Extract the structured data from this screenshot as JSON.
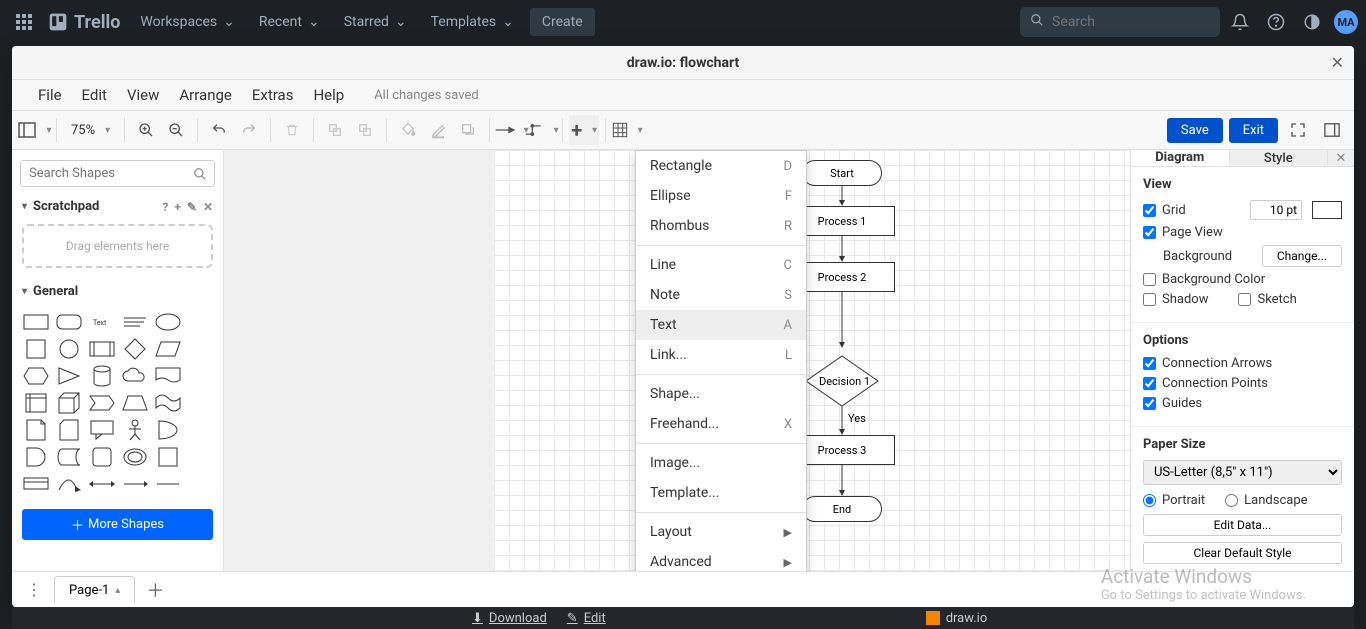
{
  "trello_nav": {
    "logo": "Trello",
    "items": [
      "Workspaces",
      "Recent",
      "Starred",
      "Templates"
    ],
    "create": "Create",
    "search_placeholder": "Search",
    "avatar": "MA"
  },
  "modal": {
    "title": "draw.io: flowchart"
  },
  "menubar": {
    "items": [
      "File",
      "Edit",
      "View",
      "Arrange",
      "Extras",
      "Help"
    ],
    "status": "All changes saved"
  },
  "toolbar": {
    "zoom": "75%",
    "save": "Save",
    "exit": "Exit"
  },
  "left_panel": {
    "search_placeholder": "Search Shapes",
    "scratchpad_title": "Scratchpad",
    "scratchpad_body": "Drag elements here",
    "general_title": "General",
    "more_shapes": "More Shapes"
  },
  "ctx_menu": {
    "items": [
      {
        "label": "Rectangle",
        "shortcut": "D"
      },
      {
        "label": "Ellipse",
        "shortcut": "F"
      },
      {
        "label": "Rhombus",
        "shortcut": "R"
      },
      {
        "divider": true
      },
      {
        "label": "Line",
        "shortcut": "C"
      },
      {
        "label": "Note",
        "shortcut": "S"
      },
      {
        "label": "Text",
        "shortcut": "A",
        "hover": true
      },
      {
        "label": "Link...",
        "shortcut": "L"
      },
      {
        "divider": true
      },
      {
        "label": "Shape..."
      },
      {
        "label": "Freehand...",
        "shortcut": "X"
      },
      {
        "divider": true
      },
      {
        "label": "Image..."
      },
      {
        "label": "Template..."
      },
      {
        "divider": true
      },
      {
        "label": "Layout",
        "submenu": true
      },
      {
        "label": "Advanced",
        "submenu": true
      }
    ]
  },
  "flow": {
    "start": "Start",
    "p1": "Process 1",
    "p2": "Process 2",
    "d1": "Decision 1",
    "yes": "Yes",
    "p3": "Process 3",
    "end": "End"
  },
  "right_panel": {
    "tab_diagram": "Diagram",
    "tab_style": "Style",
    "view_hdr": "View",
    "grid": "Grid",
    "grid_size": "10 pt",
    "page_view": "Page View",
    "background": "Background",
    "change": "Change...",
    "background_color": "Background Color",
    "shadow": "Shadow",
    "sketch": "Sketch",
    "options_hdr": "Options",
    "conn_arrows": "Connection Arrows",
    "conn_points": "Connection Points",
    "guides": "Guides",
    "paper_hdr": "Paper Size",
    "paper_value": "US-Letter (8,5\" x 11\")",
    "portrait": "Portrait",
    "landscape": "Landscape",
    "edit_data": "Edit Data...",
    "clear_style": "Clear Default Style"
  },
  "page_tabs": {
    "page1": "Page-1"
  },
  "card_strip": {
    "download": "Download",
    "edit": "Edit",
    "badge": "draw.io"
  },
  "watermark": {
    "h": "Activate Windows",
    "s": "Go to Settings to activate Windows."
  }
}
